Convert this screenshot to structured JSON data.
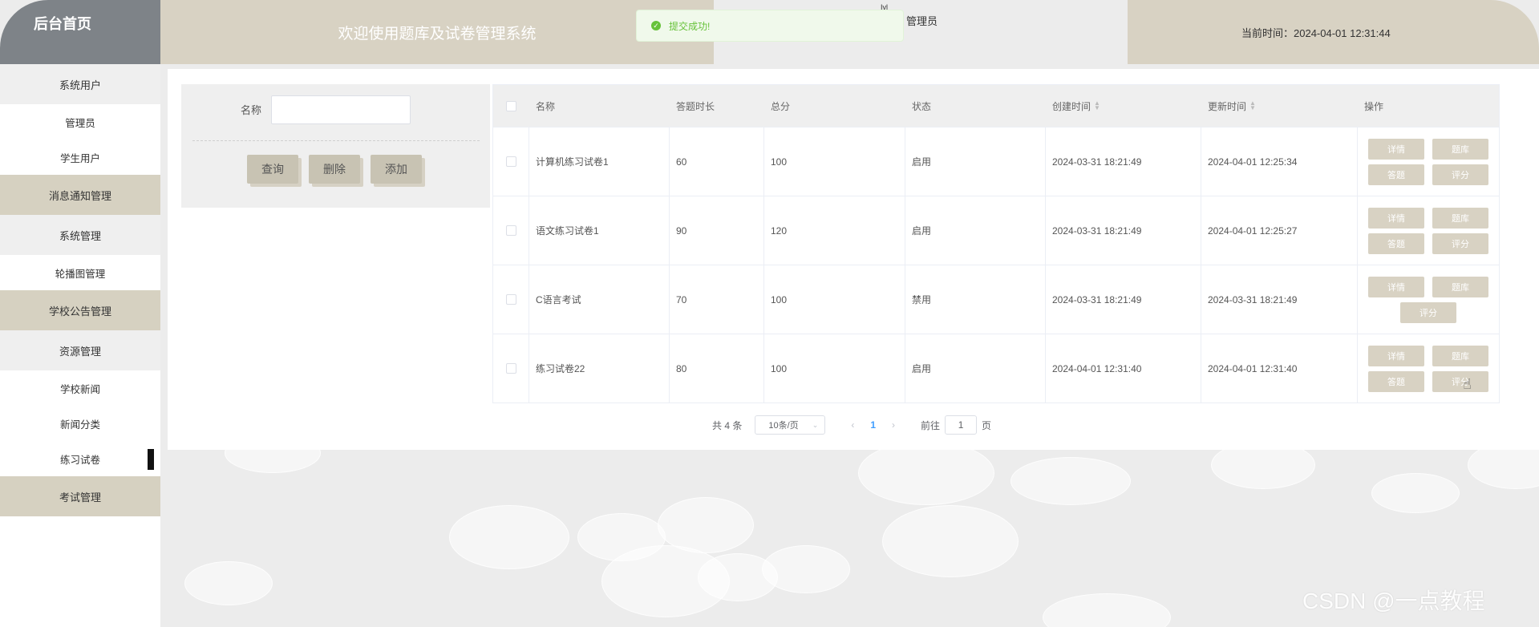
{
  "sidebar": {
    "title": "后台首页",
    "items": [
      {
        "label": "系统用户",
        "kind": "group"
      },
      {
        "label": "管理员",
        "kind": "sub"
      },
      {
        "label": "学生用户",
        "kind": "sub"
      },
      {
        "label": "消息通知管理",
        "kind": "group-dark"
      },
      {
        "label": "系统管理",
        "kind": "group"
      },
      {
        "label": "轮播图管理",
        "kind": "sub"
      },
      {
        "label": "学校公告管理",
        "kind": "group-dark"
      },
      {
        "label": "资源管理",
        "kind": "group"
      },
      {
        "label": "学校新闻",
        "kind": "sub"
      },
      {
        "label": "新闻分类",
        "kind": "sub"
      },
      {
        "label": "练习试卷",
        "kind": "sub",
        "active": true
      },
      {
        "label": "考试管理",
        "kind": "group-dark"
      }
    ]
  },
  "header": {
    "welcome": "欢迎使用题库及试卷管理系统",
    "user_mark": "Ivl",
    "user": "管理员",
    "time_label": "当前时间：2024-04-01 12:31:44"
  },
  "toast": {
    "message": "提交成功!",
    "icon": "check-circle-icon",
    "color": "#67c23a"
  },
  "search": {
    "name_label": "名称",
    "name_value": "",
    "query_label": "查询",
    "delete_label": "删除",
    "add_label": "添加"
  },
  "table": {
    "headers": {
      "name": "名称",
      "duration": "答题时长",
      "score": "总分",
      "state": "状态",
      "created": "创建时间",
      "updated": "更新时间",
      "ops": "操作"
    },
    "op_labels": {
      "detail": "详情",
      "bank": "题库",
      "answer": "答题",
      "grade": "评分"
    },
    "rows": [
      {
        "name": "计算机练习试卷1",
        "duration": "60",
        "score": "100",
        "state": "启用",
        "created": "2024-03-31 18:21:49",
        "updated": "2024-04-01 12:25:34",
        "ops": [
          "detail",
          "bank",
          "answer",
          "grade"
        ]
      },
      {
        "name": "语文练习试卷1",
        "duration": "90",
        "score": "120",
        "state": "启用",
        "created": "2024-03-31 18:21:49",
        "updated": "2024-04-01 12:25:27",
        "ops": [
          "detail",
          "bank",
          "answer",
          "grade"
        ]
      },
      {
        "name": "C语言考试",
        "duration": "70",
        "score": "100",
        "state": "禁用",
        "created": "2024-03-31 18:21:49",
        "updated": "2024-03-31 18:21:49",
        "ops": [
          "detail",
          "bank",
          "grade"
        ]
      },
      {
        "name": "练习试卷22",
        "duration": "80",
        "score": "100",
        "state": "启用",
        "created": "2024-04-01 12:31:40",
        "updated": "2024-04-01 12:31:40",
        "ops": [
          "detail",
          "bank",
          "answer",
          "grade"
        ]
      }
    ]
  },
  "pagination": {
    "total": "共 4 条",
    "page_size": "10条/页",
    "current_page": "1",
    "goto_label": "前往",
    "goto_value": "1",
    "page_suffix": "页"
  },
  "watermark": "CSDN @一点教程",
  "colors": {
    "accent": "#d8d2c3",
    "sidebar_header": "#7e8388",
    "button": "#c8c3b3",
    "success": "#67c23a",
    "pager_active": "#409eff"
  }
}
